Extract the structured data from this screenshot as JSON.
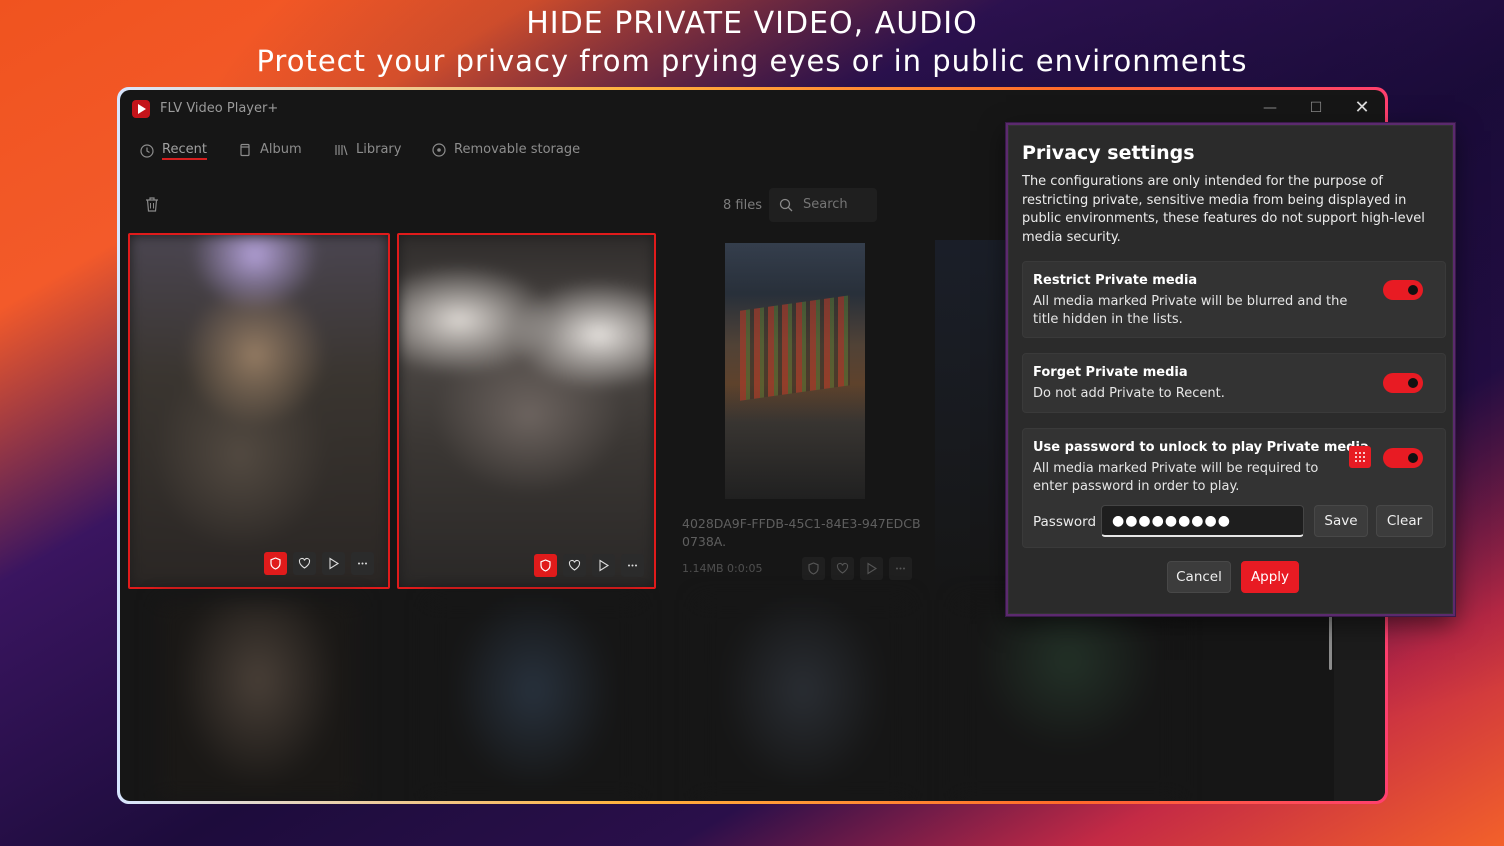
{
  "banner": {
    "title": "HIDE PRIVATE VIDEO, AUDIO",
    "subtitle": "Protect your privacy from prying eyes or in public environments"
  },
  "window": {
    "title": "FLV Video Player+",
    "minimize": "—",
    "maximize": "☐",
    "close": "✕"
  },
  "nav": {
    "items": [
      {
        "label": "Recent",
        "icon": "clock-icon",
        "active": true
      },
      {
        "label": "Album",
        "icon": "album-icon"
      },
      {
        "label": "Library",
        "icon": "library-icon"
      },
      {
        "label": "Removable storage",
        "icon": "disc-icon"
      }
    ]
  },
  "toolbar": {
    "files_count": "8 files",
    "search_placeholder": "Search"
  },
  "media": {
    "item3": {
      "name": "4028DA9F-FFDB-45C1-84E3-947EDCB0738A.",
      "size": "1.14MB",
      "duration": "0:0:05"
    }
  },
  "colors": {
    "accent": "#e81b23",
    "dialog_bg": "#2b2b2b",
    "app_bg": "#161616"
  },
  "dialog": {
    "title": "Privacy settings",
    "description": "The configurations are only intended for the purpose of restricting private, sensitive media from being displayed in public environments, these features do not support high-level media security.",
    "sections": [
      {
        "heading": "Restrict Private media",
        "body": "All media marked Private will be blurred and the title hidden in the lists.",
        "enabled": true
      },
      {
        "heading": "Forget Private media",
        "body": "Do not add Private to Recent.",
        "enabled": true
      },
      {
        "heading": "Use password to unlock to play Private media",
        "body": "All media marked Private will be required to enter password in order to play.",
        "enabled": true
      }
    ],
    "password_label": "Password",
    "password_value": "●●●●●●●●●",
    "save_label": "Save",
    "clear_label": "Clear",
    "cancel_label": "Cancel",
    "apply_label": "Apply"
  }
}
